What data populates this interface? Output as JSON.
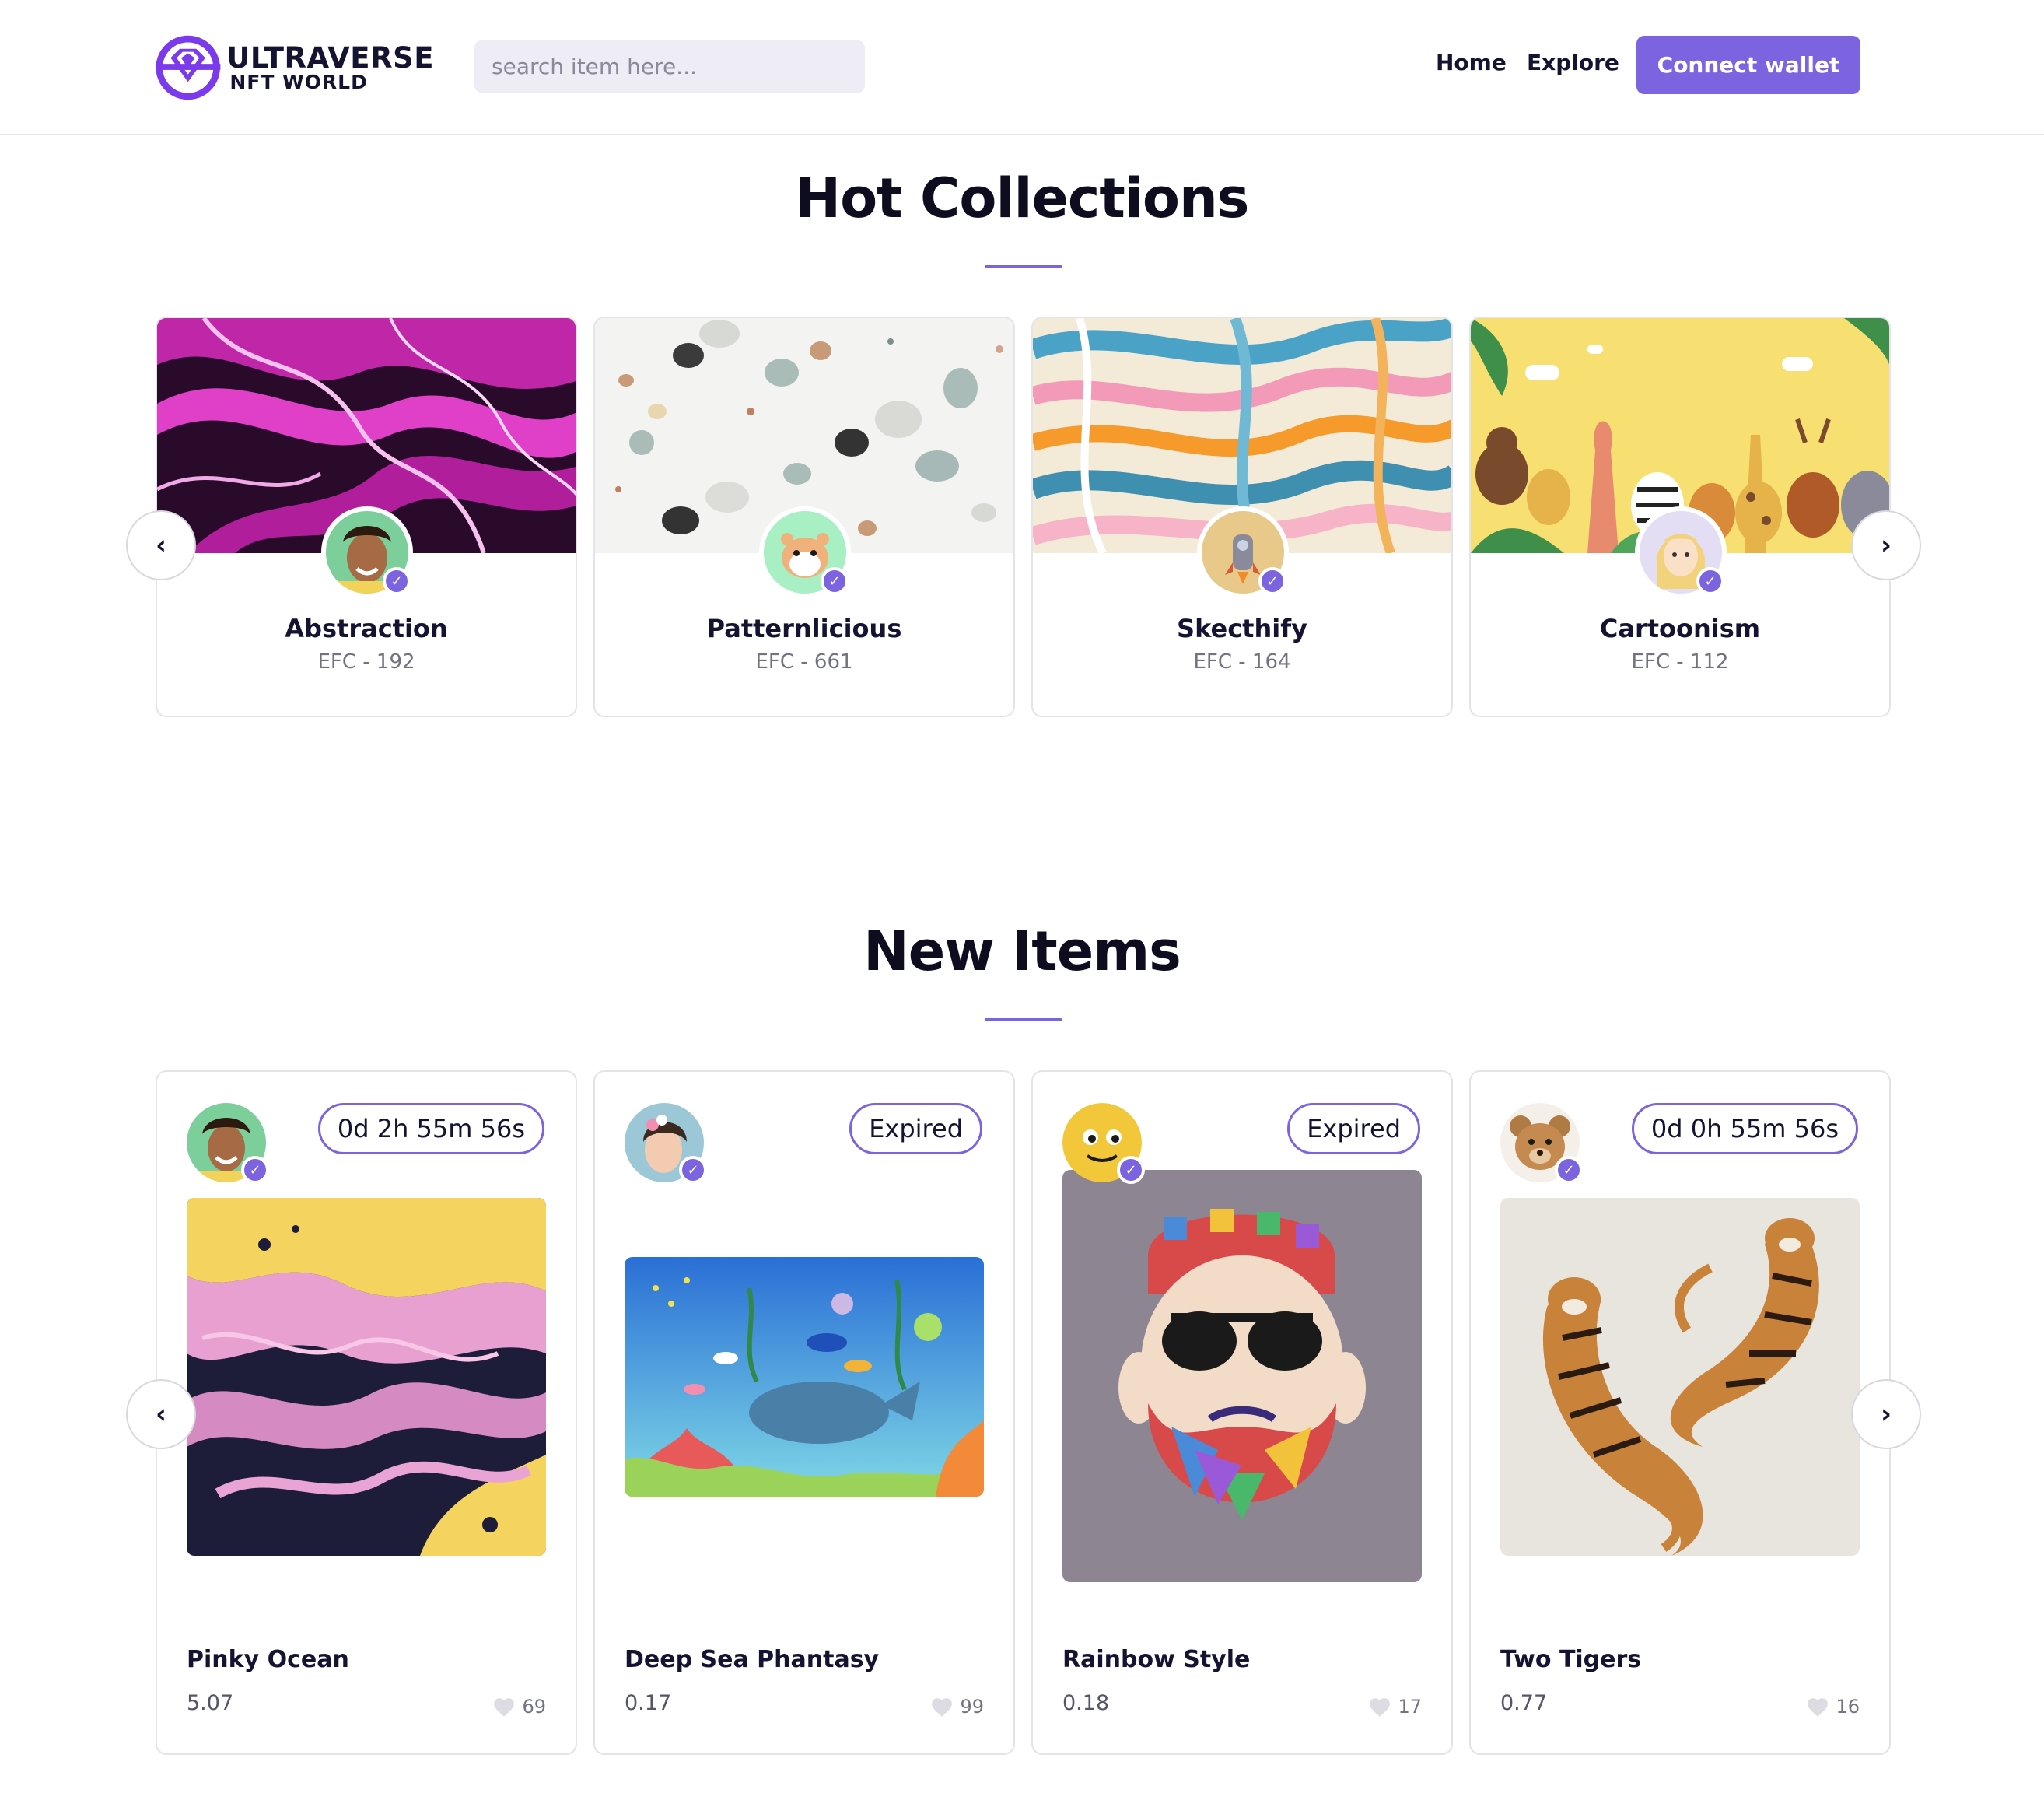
{
  "brand": {
    "name": "ULTRAVERSE",
    "tagline": "NFT WORLD",
    "accent": "#7c63e0"
  },
  "search": {
    "placeholder": "search item here..."
  },
  "nav": {
    "home": "Home",
    "explore": "Explore",
    "connect": "Connect wallet"
  },
  "hot_collections": {
    "title": "Hot Collections",
    "prev_arrow": "‹",
    "next_arrow": "›",
    "items": [
      {
        "name": "Abstraction",
        "code": "EFC - 192"
      },
      {
        "name": "Patternlicious",
        "code": "EFC - 661"
      },
      {
        "name": "Skecthify",
        "code": "EFC - 164"
      },
      {
        "name": "Cartoonism",
        "code": "EFC - 112"
      }
    ]
  },
  "new_items": {
    "title": "New Items",
    "prev_arrow": "‹",
    "next_arrow": "›",
    "items": [
      {
        "name": "Pinky Ocean",
        "price": "5.07",
        "likes": "69",
        "status": "0d 2h 55m 56s"
      },
      {
        "name": "Deep Sea Phantasy",
        "price": "0.17",
        "likes": "99",
        "status": "Expired"
      },
      {
        "name": "Rainbow Style",
        "price": "0.18",
        "likes": "17",
        "status": "Expired"
      },
      {
        "name": "Two Tigers",
        "price": "0.77",
        "likes": "16",
        "status": "0d 0h 55m 56s"
      }
    ]
  }
}
